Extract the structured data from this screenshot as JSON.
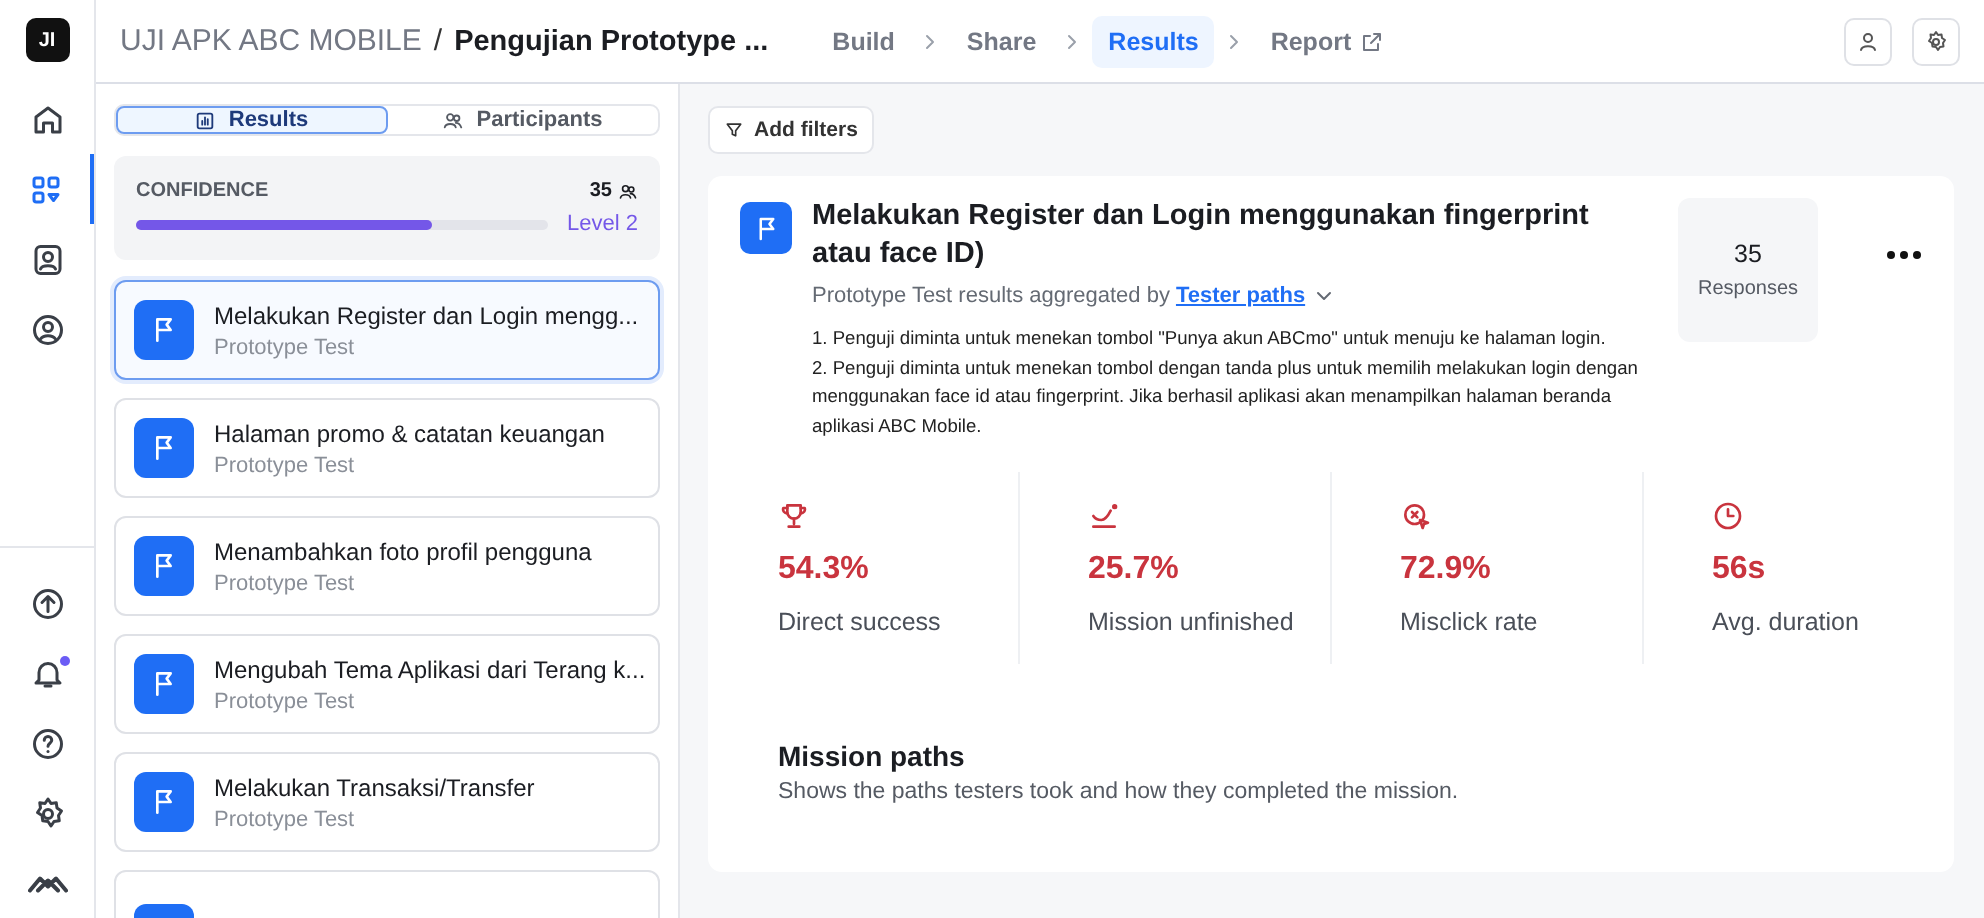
{
  "header": {
    "logo": "JI",
    "project": "UJI APK ABC MOBILE",
    "separator": "/",
    "title": "Pengujian Prototype ...",
    "steps": [
      {
        "label": "Build",
        "selected": false,
        "external": false
      },
      {
        "label": "Share",
        "selected": false,
        "external": false
      },
      {
        "label": "Results",
        "selected": true,
        "external": false
      },
      {
        "label": "Report",
        "selected": false,
        "external": true
      }
    ]
  },
  "rail": {
    "top": [
      {
        "selected": false
      },
      {
        "selected": true
      },
      {
        "selected": false
      },
      {
        "selected": false
      }
    ],
    "bottom": [
      {
        "badge": false
      },
      {
        "badge": true
      },
      {
        "badge": false
      },
      {
        "badge": false
      },
      {
        "badge": false
      }
    ]
  },
  "view_tabs": [
    {
      "label": "Results",
      "selected": true
    },
    {
      "label": "Participants",
      "selected": false
    }
  ],
  "confidence": {
    "label": "CONFIDENCE",
    "count": "35",
    "level": 0.72,
    "level_label": "Level 2"
  },
  "tasks": [
    {
      "title": "Melakukan Register dan Login mengg...",
      "subtitle": "Prototype Test",
      "selected": true
    },
    {
      "title": "Halaman promo & catatan keuangan",
      "subtitle": "Prototype Test",
      "selected": false
    },
    {
      "title": "Menambahkan foto profil pengguna",
      "subtitle": "Prototype Test",
      "selected": false
    },
    {
      "title": "Mengubah Tema Aplikasi dari Terang k...",
      "subtitle": "Prototype Test",
      "selected": false
    },
    {
      "title": "Melakukan Transaksi/Transfer",
      "subtitle": "Prototype Test",
      "selected": false
    }
  ],
  "tasks_more": true,
  "filters": {
    "label": "Add filters"
  },
  "detail": {
    "title": "Melakukan Register dan Login menggunakan fingerprint atau face ID)",
    "aggregated_by": "Prototype Test results aggregated by",
    "aggregate_link": "Tester paths",
    "instructions": [
      "1. Penguji diminta untuk menekan tombol \"Punya akun ABCmo\" untuk menuju ke halaman login.",
      "2. Penguji diminta untuk menekan tombol dengan tanda plus untuk memilih melakukan login dengan menggunakan face id atau fingerprint. Jika berhasil aplikasi akan menampilkan halaman beranda aplikasi ABC Mobile."
    ],
    "responses": {
      "count": "35",
      "label": "Responses"
    }
  },
  "stats": [
    {
      "kind": "trophy",
      "value": "54.3%",
      "label": "Direct success"
    },
    {
      "kind": "unfinished",
      "value": "25.7%",
      "label": "Mission unfinished"
    },
    {
      "kind": "misclick",
      "value": "72.9%",
      "label": "Misclick rate"
    },
    {
      "kind": "clock",
      "value": "56s",
      "label": "Avg. duration"
    }
  ],
  "mission_paths": {
    "title": "Mission paths",
    "description": "Shows the paths testers took and how they completed the mission."
  }
}
